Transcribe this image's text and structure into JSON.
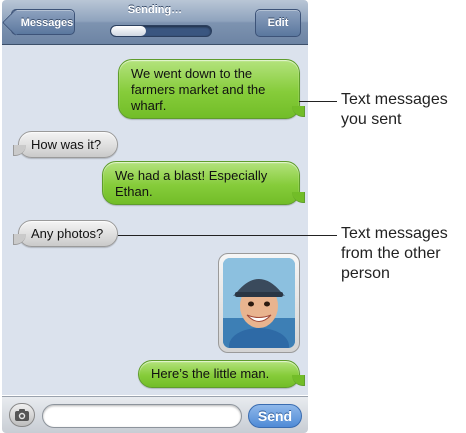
{
  "navbar": {
    "back_label": "Messages",
    "status_text": "Sending…",
    "edit_label": "Edit",
    "progress_fraction": 0.35
  },
  "messages": [
    {
      "direction": "sent",
      "text": "We went down to the farmers market and the wharf."
    },
    {
      "direction": "received",
      "text": "How was it?"
    },
    {
      "direction": "sent",
      "text": "We had a blast! Especially Ethan."
    },
    {
      "direction": "received",
      "text": "Any photos?"
    },
    {
      "direction": "sent",
      "type": "photo",
      "icon": "boy-photo"
    },
    {
      "direction": "sent",
      "text": "Here’s the little man."
    }
  ],
  "input_bar": {
    "camera_icon": "camera-icon",
    "placeholder": "",
    "send_label": "Send"
  },
  "callouts": {
    "sent": "Text messages you sent",
    "received": "Text messages from the other person"
  },
  "colors": {
    "sent_bubble": "#86cc3a",
    "received_bubble": "#d9d9d9",
    "chat_background": "#dbe2ed",
    "navbar": "#7d93b0",
    "send_button": "#4f8ad6"
  }
}
